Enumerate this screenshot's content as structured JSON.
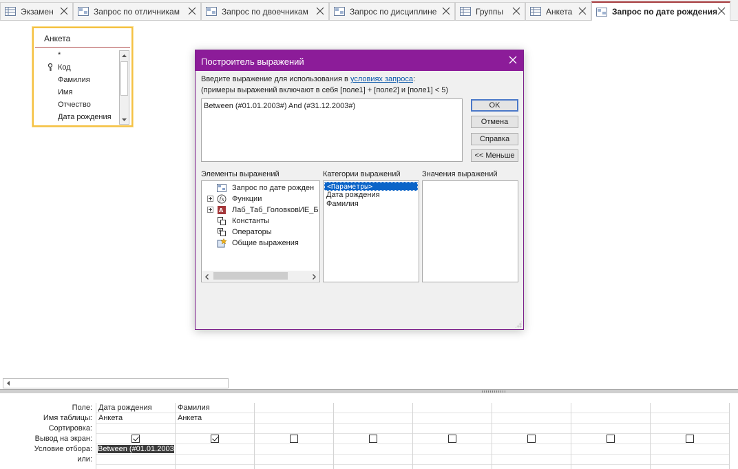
{
  "tabs": [
    {
      "label": "Экзамен",
      "icon": "table-icon",
      "active": false
    },
    {
      "label": "Запрос по отличникам",
      "icon": "query-icon",
      "active": false
    },
    {
      "label": "Запрос по двоечникам",
      "icon": "query-icon",
      "active": false
    },
    {
      "label": "Запрос по дисциплине",
      "icon": "query-icon",
      "active": false
    },
    {
      "label": "Группы",
      "icon": "table-icon",
      "active": false
    },
    {
      "label": "Анкета",
      "icon": "table-icon",
      "active": false
    },
    {
      "label": "Запрос по дате рождения",
      "icon": "query-icon",
      "active": true
    }
  ],
  "field_list": {
    "title": "Анкета",
    "items": [
      "*",
      "Код",
      "Фамилия",
      "Имя",
      "Отчество",
      "Дата рождения"
    ]
  },
  "dialog": {
    "title": "Построитель выражений",
    "prompt_prefix": "Введите выражение для использования в ",
    "prompt_link": "условиях запроса",
    "prompt_suffix": ":",
    "examples": "(примеры выражений включают в себя [поле1] + [поле2] и [поле1] < 5)",
    "expression": "Between (#01.01.2003#) And (#31.12.2003#)",
    "buttons": {
      "ok": "OK",
      "cancel": "Отмена",
      "help": "Справка",
      "less": "<< Меньше"
    },
    "elements_label": "Элементы выражений",
    "categories_label": "Категории выражений",
    "values_label": "Значения выражений",
    "elements": [
      {
        "label": "Запрос по дате рожден",
        "icon": "query-icon",
        "expandable": false
      },
      {
        "label": "Функции",
        "icon": "function-icon",
        "expandable": true
      },
      {
        "label": "Лаб_Таб_ГоловковИЕ_Б",
        "icon": "database-icon",
        "expandable": true
      },
      {
        "label": "Константы",
        "icon": "constants-icon",
        "expandable": false
      },
      {
        "label": "Операторы",
        "icon": "operators-icon",
        "expandable": false
      },
      {
        "label": "Общие выражения",
        "icon": "common-expressions-icon",
        "expandable": false
      }
    ],
    "categories": [
      "<Параметры>",
      "Дата рождения",
      "Фамилия"
    ],
    "selected_category": 0
  },
  "qbe": {
    "row_labels": [
      "Поле:",
      "Имя таблицы:",
      "Сортировка:",
      "Вывод на экран:",
      "Условие отбора:",
      "или:"
    ],
    "columns": [
      {
        "field": "Дата рождения",
        "table": "Анкета",
        "sort": "",
        "show": true,
        "criteria": "Between (#01.01.2003"
      },
      {
        "field": "Фамилия",
        "table": "Анкета",
        "sort": "",
        "show": true,
        "criteria": ""
      },
      {
        "field": "",
        "table": "",
        "sort": "",
        "show": false,
        "criteria": ""
      },
      {
        "field": "",
        "table": "",
        "sort": "",
        "show": false,
        "criteria": ""
      },
      {
        "field": "",
        "table": "",
        "sort": "",
        "show": false,
        "criteria": ""
      },
      {
        "field": "",
        "table": "",
        "sort": "",
        "show": false,
        "criteria": ""
      },
      {
        "field": "",
        "table": "",
        "sort": "",
        "show": false,
        "criteria": ""
      },
      {
        "field": "",
        "table": "",
        "sort": "",
        "show": false,
        "criteria": ""
      }
    ]
  },
  "colors": {
    "accent": "#8c1c99",
    "tab_accent": "#a4373a",
    "selection": "#0a64c8"
  }
}
